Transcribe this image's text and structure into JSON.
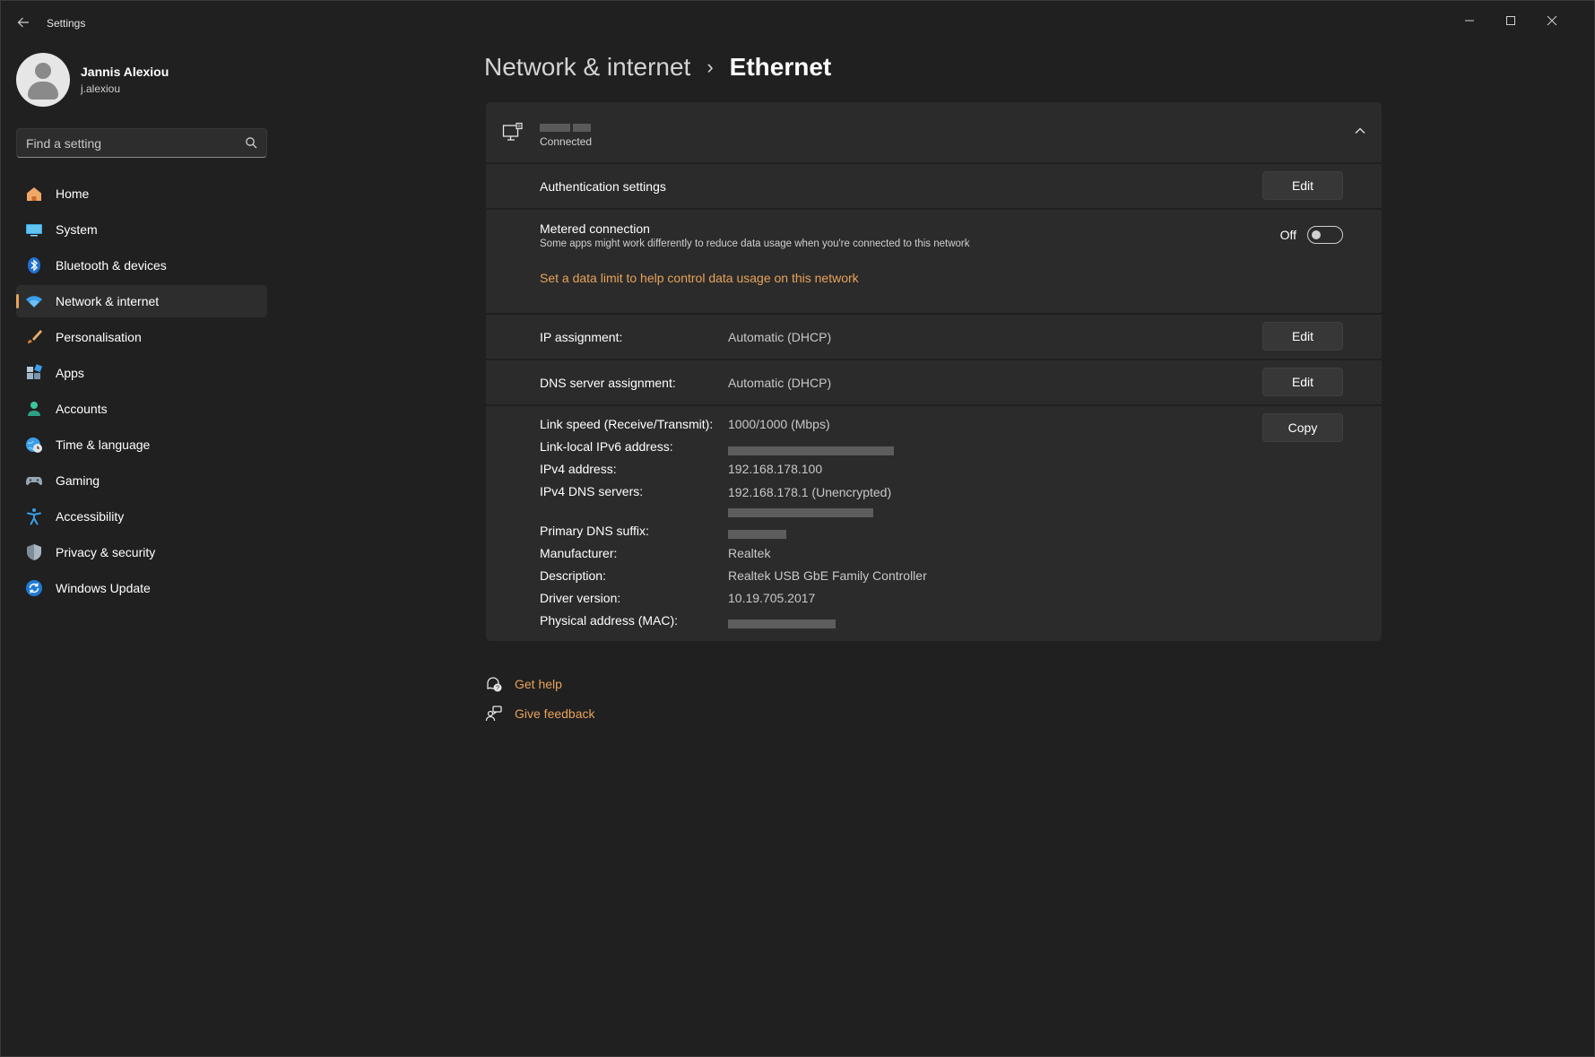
{
  "window": {
    "app_title": "Settings"
  },
  "profile": {
    "name": "Jannis Alexiou",
    "email": "j.alexiou"
  },
  "search": {
    "placeholder": "Find a setting"
  },
  "sidebar": {
    "items": [
      {
        "label": "Home",
        "icon": "home-icon"
      },
      {
        "label": "System",
        "icon": "system-icon"
      },
      {
        "label": "Bluetooth & devices",
        "icon": "bluetooth-icon"
      },
      {
        "label": "Network & internet",
        "icon": "wifi-icon",
        "active": true
      },
      {
        "label": "Personalisation",
        "icon": "brush-icon"
      },
      {
        "label": "Apps",
        "icon": "apps-icon"
      },
      {
        "label": "Accounts",
        "icon": "accounts-icon"
      },
      {
        "label": "Time & language",
        "icon": "globe-clock-icon"
      },
      {
        "label": "Gaming",
        "icon": "gamepad-icon"
      },
      {
        "label": "Accessibility",
        "icon": "accessibility-icon"
      },
      {
        "label": "Privacy & security",
        "icon": "shield-icon"
      },
      {
        "label": "Windows Update",
        "icon": "update-icon"
      }
    ]
  },
  "breadcrumb": {
    "parent": "Network & internet",
    "separator": "›",
    "current": "Ethernet"
  },
  "connection": {
    "status": "Connected"
  },
  "auth": {
    "label": "Authentication settings",
    "button": "Edit"
  },
  "metered": {
    "label": "Metered connection",
    "description": "Some apps might work differently to reduce data usage when you're connected to this network",
    "toggle_label": "Off",
    "link": "Set a data limit to help control data usage on this network"
  },
  "ip": {
    "label": "IP assignment:",
    "value": "Automatic (DHCP)",
    "button": "Edit"
  },
  "dns": {
    "label": "DNS server assignment:",
    "value": "Automatic (DHCP)",
    "button": "Edit"
  },
  "properties": {
    "copy_button": "Copy",
    "link_speed_label": "Link speed (Receive/Transmit):",
    "link_speed_value": "1000/1000 (Mbps)",
    "ipv6_label": "Link-local IPv6 address:",
    "ipv4_label": "IPv4 address:",
    "ipv4_value": "192.168.178.100",
    "ipv4_dns_label": "IPv4 DNS servers:",
    "ipv4_dns_value": "192.168.178.1 (Unencrypted)",
    "dns_suffix_label": "Primary DNS suffix:",
    "manufacturer_label": "Manufacturer:",
    "manufacturer_value": "Realtek",
    "description_label": "Description:",
    "description_value": "Realtek USB GbE Family Controller",
    "driver_label": "Driver version:",
    "driver_value": "10.19.705.2017",
    "mac_label": "Physical address (MAC):"
  },
  "help": {
    "get_help": "Get help",
    "give_feedback": "Give feedback"
  },
  "colors": {
    "background": "#202020",
    "card": "#2b2b2b",
    "accent": "#e8a25a"
  }
}
